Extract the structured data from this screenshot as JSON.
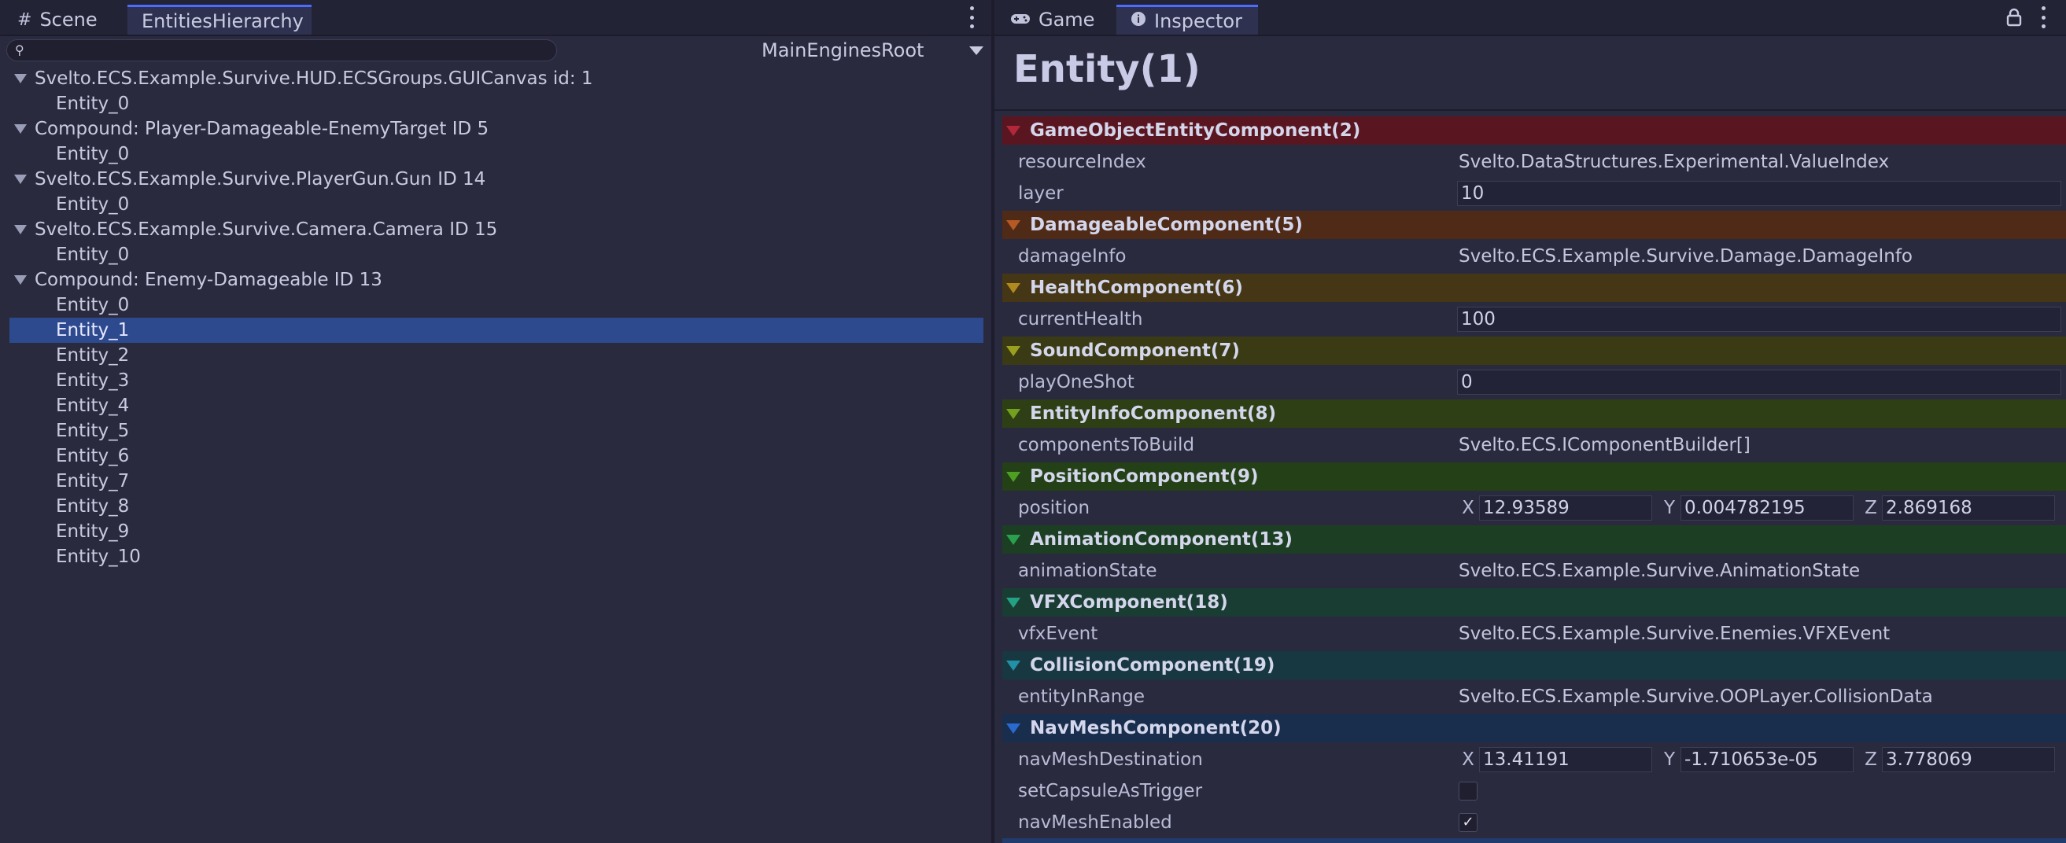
{
  "left_panel": {
    "tabs": [
      {
        "label": "Scene",
        "icon": "#"
      },
      {
        "label": "EntitiesHierarchy"
      }
    ],
    "search": {
      "placeholder": ""
    },
    "root_selector": "MainEnginesRoot",
    "tree": [
      {
        "label": "Svelto.ECS.Example.Survive.HUD.ECSGroups.GUICanvas id: 1",
        "children": [
          "Entity_0"
        ]
      },
      {
        "label": "Compound: Player-Damageable-EnemyTarget ID 5",
        "children": [
          "Entity_0"
        ]
      },
      {
        "label": "Svelto.ECS.Example.Survive.PlayerGun.Gun ID 14",
        "children": [
          "Entity_0"
        ]
      },
      {
        "label": "Svelto.ECS.Example.Survive.Camera.Camera ID 15",
        "children": [
          "Entity_0"
        ]
      },
      {
        "label": "Compound: Enemy-Damageable ID 13",
        "children": [
          "Entity_0",
          "Entity_1",
          "Entity_2",
          "Entity_3",
          "Entity_4",
          "Entity_5",
          "Entity_6",
          "Entity_7",
          "Entity_8",
          "Entity_9",
          "Entity_10"
        ]
      }
    ],
    "selected": "Entity_1"
  },
  "right_panel": {
    "tabs": [
      {
        "label": "Game",
        "icon": "gamepad-icon"
      },
      {
        "label": "Inspector",
        "icon": "info-icon"
      }
    ],
    "entity_title": "Entity(1)",
    "components": [
      {
        "name": "GameObjectEntityComponent(2)",
        "bg": "#5a1620",
        "arrow": "#b0283a",
        "props": [
          {
            "name": "resourceIndex",
            "type": "text",
            "value": "Svelto.DataStructures.Experimental.ValueIndex"
          },
          {
            "name": "layer",
            "type": "field",
            "value": "10"
          }
        ]
      },
      {
        "name": "DamageableComponent(5)",
        "bg": "#4e2a17",
        "arrow": "#b55a24",
        "props": [
          {
            "name": "damageInfo",
            "type": "text",
            "value": "Svelto.ECS.Example.Survive.Damage.DamageInfo"
          }
        ]
      },
      {
        "name": "HealthComponent(6)",
        "bg": "#453615",
        "arrow": "#b08a1e",
        "props": [
          {
            "name": "currentHealth",
            "type": "field",
            "value": "100"
          }
        ]
      },
      {
        "name": "SoundComponent(7)",
        "bg": "#3a3b15",
        "arrow": "#9aa01e",
        "props": [
          {
            "name": "playOneShot",
            "type": "field",
            "value": "0"
          }
        ]
      },
      {
        "name": "EntityInfoComponent(8)",
        "bg": "#2e3f16",
        "arrow": "#73a01e",
        "props": [
          {
            "name": "componentsToBuild",
            "type": "text",
            "value": "Svelto.ECS.IComponentBuilder[]"
          }
        ]
      },
      {
        "name": "PositionComponent(9)",
        "bg": "#234017",
        "arrow": "#4da022",
        "props": [
          {
            "name": "position",
            "type": "vector",
            "values": {
              "X": "12.93589",
              "Y": "0.004782195",
              "Z": "2.869168"
            }
          }
        ]
      },
      {
        "name": "AnimationComponent(13)",
        "bg": "#1c3f24",
        "arrow": "#2aa04e",
        "props": [
          {
            "name": "animationState",
            "type": "text",
            "value": "Svelto.ECS.Example.Survive.AnimationState"
          }
        ]
      },
      {
        "name": "VFXComponent(18)",
        "bg": "#193d33",
        "arrow": "#24a085",
        "props": [
          {
            "name": "vfxEvent",
            "type": "text",
            "value": "Svelto.ECS.Example.Survive.Enemies.VFXEvent"
          }
        ]
      },
      {
        "name": "CollisionComponent(19)",
        "bg": "#183841",
        "arrow": "#2291a8",
        "props": [
          {
            "name": "entityInRange",
            "type": "text",
            "value": "Svelto.ECS.Example.Survive.OOPLayer.CollisionData"
          }
        ]
      },
      {
        "name": "NavMeshComponent(20)",
        "bg": "#182e4c",
        "arrow": "#2a6ad0",
        "props": [
          {
            "name": "navMeshDestination",
            "type": "vector",
            "values": {
              "X": "13.41191",
              "Y": "-1.710653e-05",
              "Z": "3.778069"
            }
          },
          {
            "name": "setCapsuleAsTrigger",
            "type": "checkbox",
            "checked": false
          },
          {
            "name": "navMeshEnabled",
            "type": "checkbox",
            "checked": true
          }
        ]
      }
    ]
  }
}
